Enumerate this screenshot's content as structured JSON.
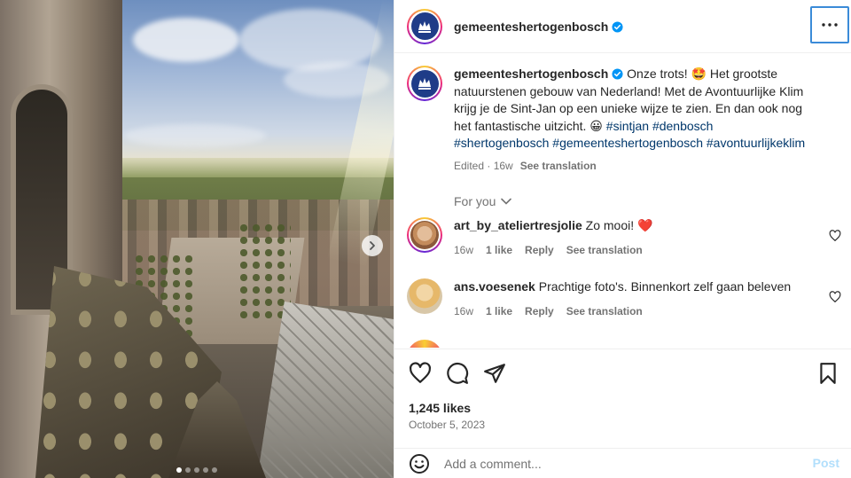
{
  "post": {
    "username": "gemeenteshertogenbosch",
    "caption_user": "gemeenteshertogenbosch",
    "caption_line1": "Onze trots! 🤩 Het grootste",
    "caption_line2": "natuurstenen gebouw van Nederland! Met de Avontuurlijke Klim",
    "caption_line3": "krijg je de Sint-Jan op een unieke wijze te zien. En dan ook nog",
    "caption_line4": "het fantastische uitzicht. 😀 ",
    "tags_line4": "#sintjan #denbosch",
    "tags_line5": "#shertogenbosch #gemeenteshertogenbosch #avontuurlijkeklim",
    "edited": "Edited · 16w",
    "see_translation": "See translation",
    "for_you": "For you",
    "likes": "1,245 likes",
    "date": "October 5, 2023",
    "add_comment_placeholder": "Add a comment...",
    "post_label": "Post"
  },
  "comments": [
    {
      "user": "art_by_ateliertresjolie",
      "text": "Zo mooi! ❤️",
      "age": "16w",
      "likes": "1 like",
      "reply": "Reply",
      "translate": "See translation"
    },
    {
      "user": "ans.voesenek",
      "text": "Prachtige foto's. Binnenkort zelf gaan beleven",
      "age": "16w",
      "likes": "1 like",
      "reply": "Reply",
      "translate": "See translation"
    }
  ],
  "colors": {
    "verified": "#0095f6",
    "link": "#00376b",
    "muted": "#737373",
    "post_disabled": "#b2dffc",
    "focus_ring": "#3b8bd8"
  },
  "icons": [
    "verified-badge-icon",
    "more-options-icon",
    "chevron-right-icon",
    "heart-icon",
    "comment-icon",
    "share-icon",
    "bookmark-icon",
    "emoji-icon",
    "chevron-down-icon"
  ]
}
